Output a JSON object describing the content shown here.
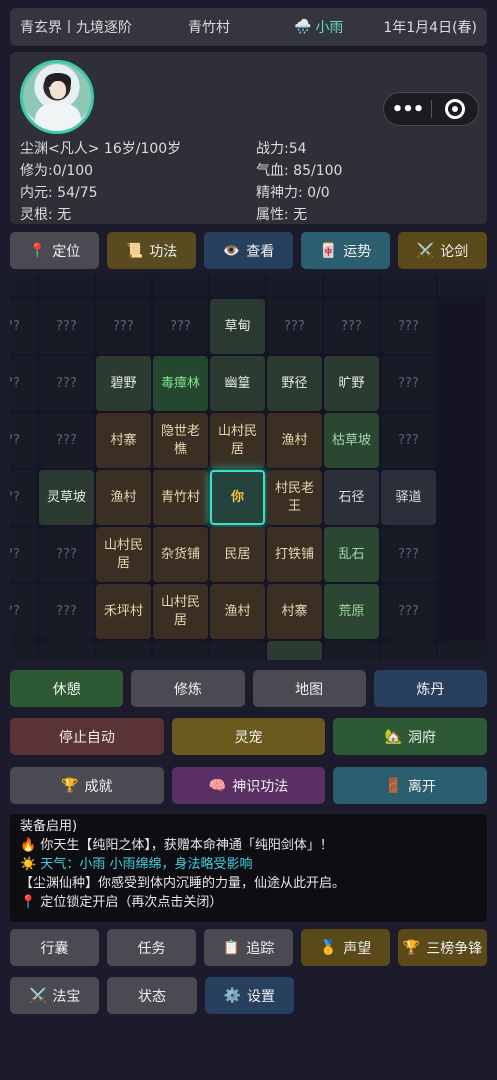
{
  "topbar": {
    "realm": "青玄界丨九境逐阶",
    "village": "青竹村",
    "weather": "小雨",
    "weather_icon": "rain-cloud-icon",
    "date": "1年1月4日(春)"
  },
  "profile": {
    "name_line": "尘渊<凡人> 16岁/100岁",
    "power": "战力:54",
    "cultivation": "修为:0/100",
    "hp": "气血: 85/100",
    "yuan": "内元: 54/75",
    "spirit": "精神力: 0/0",
    "root": "灵根: 无",
    "attribute": "属性: 无",
    "capsule_dots": "•••"
  },
  "row1": [
    {
      "label": "定位",
      "icon": "📍",
      "color": "#4a4a52"
    },
    {
      "label": "功法",
      "icon": "📜",
      "color": "#5a4a1f"
    },
    {
      "label": "查看",
      "icon": "👁️",
      "color": "#27405e"
    },
    {
      "label": "运势",
      "icon": "🀄",
      "color": "#2b5f6f"
    },
    {
      "label": "论剑",
      "icon": "⚔️",
      "color": "#5a4a1a"
    }
  ],
  "map": {
    "rows": [
      [
        "???",
        "???",
        "???",
        "???",
        "草甸",
        "???",
        "???",
        "???"
      ],
      [
        "???",
        "???",
        "碧野",
        "毒瘴林",
        "幽篁",
        "野径",
        "旷野",
        "???"
      ],
      [
        "???",
        "???",
        "村寨",
        "隐世老樵",
        "山村民居",
        "渔村",
        "枯草坡",
        "???"
      ],
      [
        "???",
        "灵草坡",
        "渔村",
        "青竹村",
        "你",
        "村民老王",
        "石径",
        "驿道"
      ],
      [
        "???",
        "???",
        "山村民居",
        "杂货铺",
        "民居",
        "打铁铺",
        "乱石",
        "???"
      ],
      [
        "???",
        "???",
        "禾坪村",
        "山村民居",
        "渔村",
        "村寨",
        "荒原",
        "???"
      ]
    ],
    "types": [
      [
        "unk",
        "unk",
        "unk",
        "unk",
        "plain",
        "unk",
        "unk",
        "unk"
      ],
      [
        "unk",
        "unk",
        "plain",
        "forest",
        "plain",
        "plain",
        "plain",
        "unk"
      ],
      [
        "unk",
        "unk",
        "rural",
        "rural",
        "rural",
        "rural",
        "green",
        "unk"
      ],
      [
        "unk",
        "plain",
        "rural",
        "rural",
        "cur",
        "rural",
        "road",
        "road"
      ],
      [
        "unk",
        "unk",
        "rural",
        "rural",
        "rural",
        "rural",
        "green",
        "unk"
      ],
      [
        "unk",
        "unk",
        "rural",
        "rural",
        "rural",
        "rural",
        "green",
        "unk"
      ]
    ],
    "current_label": "你"
  },
  "row2": [
    {
      "label": "休憩",
      "color": "#2d5a34"
    },
    {
      "label": "修炼",
      "color": "#4a4a52"
    },
    {
      "label": "地图",
      "color": "#4a4a52"
    },
    {
      "label": "炼丹",
      "color": "#27405e"
    }
  ],
  "row3": [
    {
      "label": "停止自动",
      "icon": "",
      "color": "#5a3434"
    },
    {
      "label": "灵宠",
      "icon": "",
      "color": "#6a5a1e"
    },
    {
      "label": "洞府",
      "icon": "🏡",
      "color": "#2d5a34"
    }
  ],
  "row4": [
    {
      "label": "成就",
      "icon": "🏆",
      "color": "#4a4a52"
    },
    {
      "label": "神识功法",
      "icon": "🧠",
      "color": "#5a2f63"
    },
    {
      "label": "离开",
      "icon": "🚪",
      "color": "#2b5f6f"
    }
  ],
  "log": [
    {
      "icon": "",
      "text": "装备启用)",
      "cls": ""
    },
    {
      "icon": "🔥",
      "text": "你天生【纯阳之体】，获赠本命神通「纯阳剑体」！",
      "cls": ""
    },
    {
      "icon": "☀️",
      "text": "天气：小雨 小雨绵绵，身法略受影响",
      "cls": "cyan"
    },
    {
      "icon": "",
      "text": "【尘渊仙种】你感受到体内沉睡的力量，仙途从此开启。",
      "cls": ""
    },
    {
      "icon": "📍",
      "text": "定位锁定开启（再次点击关闭）",
      "cls": ""
    }
  ],
  "row5": [
    {
      "label": "行囊",
      "icon": "",
      "color": "#4a4a52"
    },
    {
      "label": "任务",
      "icon": "",
      "color": "#4a4a52"
    },
    {
      "label": "追踪",
      "icon": "📋",
      "color": "#4a4a52"
    },
    {
      "label": "声望",
      "icon": "🥇",
      "color": "#5a4a1a"
    },
    {
      "label": "三榜争锋",
      "icon": "🏆",
      "color": "#5a4a1a"
    }
  ],
  "row6": [
    {
      "label": "法宝",
      "icon": "⚔️",
      "color": "#4a4a52"
    },
    {
      "label": "状态",
      "icon": "",
      "color": "#4a4a52"
    },
    {
      "label": "设置",
      "icon": "⚙️",
      "color": "#27405e"
    }
  ]
}
